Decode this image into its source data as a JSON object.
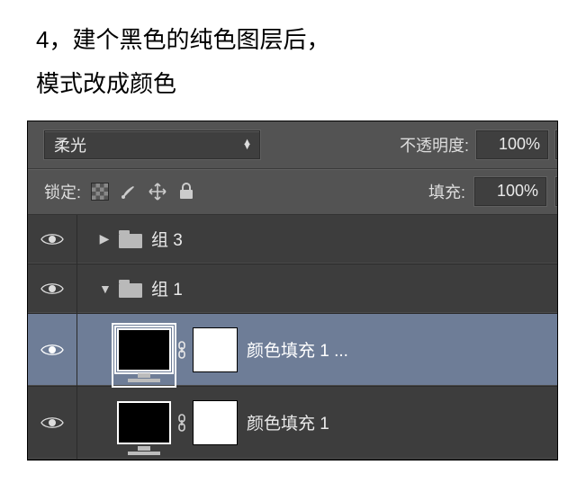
{
  "instruction": {
    "line1": "4，建个黑色的纯色图层后，",
    "line2": "模式改成颜色"
  },
  "panel": {
    "blend_mode": "柔光",
    "opacity_label": "不透明度:",
    "opacity_value": "100%",
    "lock_label": "锁定:",
    "fill_label": "填充:",
    "fill_value": "100%",
    "layers": [
      {
        "type": "group",
        "open": false,
        "name": "组 3"
      },
      {
        "type": "group",
        "open": true,
        "name": "组 1"
      },
      {
        "type": "colorfill",
        "selected": true,
        "name": "颜色填充 1 ..."
      },
      {
        "type": "colorfill",
        "selected": false,
        "name": "颜色填充 1"
      }
    ]
  }
}
